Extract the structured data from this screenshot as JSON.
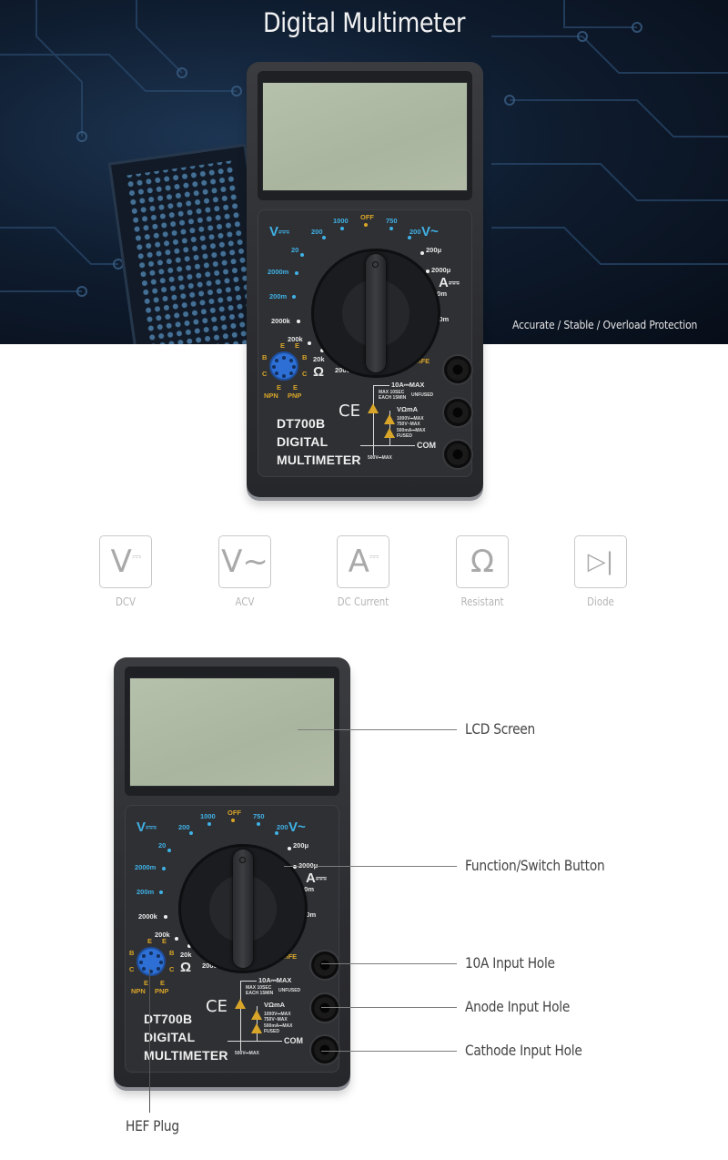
{
  "hero": {
    "title": "Digital Multimeter",
    "tagline": "Accurate / Stable / Overload Protection"
  },
  "meter": {
    "model": "DT700B",
    "line2": "DIGITAL",
    "line3": "MULTIMETER",
    "ce_mark": "CE",
    "dcv_symbol": "V⎓",
    "acv_symbol": "V~",
    "dca_symbol": "A⎓",
    "ohm_symbol": "Ω",
    "off": "OFF",
    "dcv_ranges": [
      "1000",
      "200",
      "20",
      "2000m",
      "200m"
    ],
    "acv_ranges": [
      "750",
      "200"
    ],
    "dca_ranges": [
      "200μ",
      "2000μ",
      "20m",
      "200m",
      "10"
    ],
    "ohm_ranges": [
      "2000k",
      "200k",
      "20k",
      "2000",
      "200"
    ],
    "hfe": "hFE",
    "diode_symbol": "▶|",
    "transistor_pins_left": [
      "E",
      "B",
      "C",
      "E"
    ],
    "transistor_pins_right": [
      "E",
      "B",
      "C",
      "E"
    ],
    "npn": "NPN",
    "pnp": "PNP",
    "jack_10a": "10A⎓MAX",
    "jack_10a_note1": "MAX 10SEC",
    "jack_10a_note2": "EACH 15MIN",
    "unfused": "UNFUSED",
    "jack_vomA": "VΩmA",
    "vomA_note1": "1000V⎓MAX",
    "vomA_note2": "750V~MAX",
    "vomA_note3": "500mA⎓MAX",
    "fused": "FUSED",
    "jack_com": "COM",
    "com_note": "500V⎓MAX"
  },
  "modes": [
    {
      "symbol": "V",
      "sub": "⎓",
      "label": "DCV"
    },
    {
      "symbol": "V~",
      "sub": "",
      "label": "ACV"
    },
    {
      "symbol": "A",
      "sub": "⎓",
      "label": "DC Current"
    },
    {
      "symbol": "Ω",
      "sub": "",
      "label": "Resistant"
    },
    {
      "symbol": "▷|",
      "sub": "",
      "label": "Diode"
    }
  ],
  "callouts": {
    "lcd": "LCD Screen",
    "function_switch": "Function/Switch Button",
    "input_10a": "10A Input Hole",
    "anode": "Anode Input Hole",
    "cathode": "Cathode Input Hole",
    "hef_plug": "HEF Plug"
  }
}
